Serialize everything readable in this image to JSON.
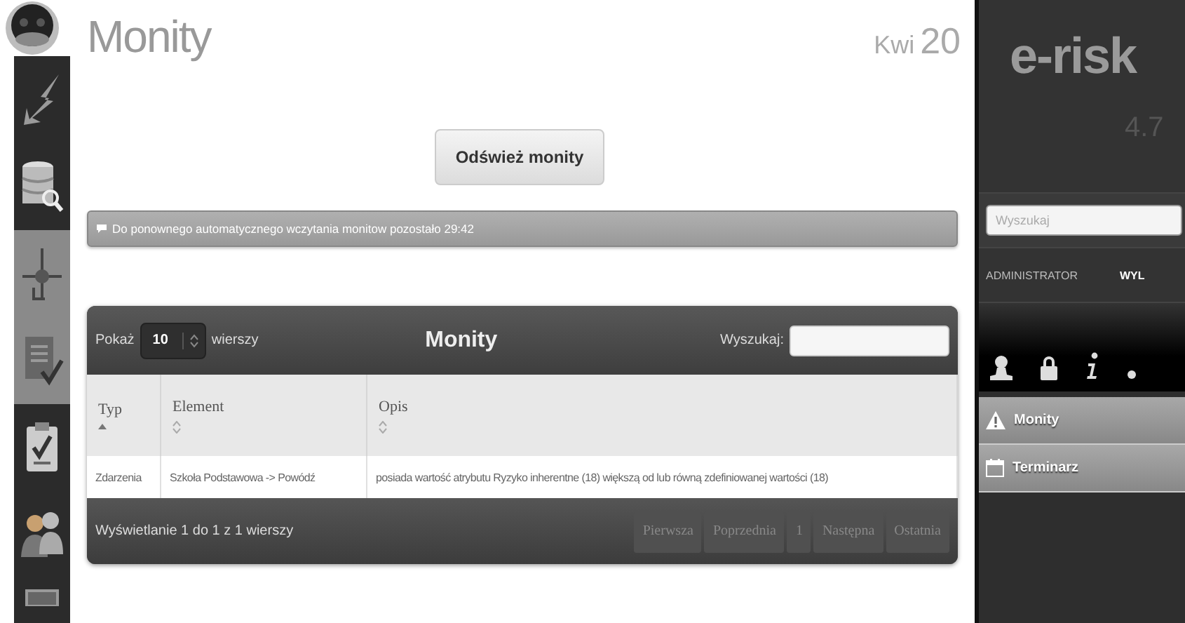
{
  "page": {
    "title": "Monity",
    "date": {
      "month": "Kwi",
      "day": "20"
    }
  },
  "refresh_button": "Odśwież monity",
  "notice": "Do ponownego automatycznego wczytania monitow pozostało 29:42",
  "table": {
    "title": "Monity",
    "length": {
      "label_before": "Pokaż",
      "value": "10",
      "label_after": "wierszy"
    },
    "search": {
      "label": "Wyszukaj:"
    },
    "columns": [
      {
        "label": "Typ",
        "sorted": true
      },
      {
        "label": "Element",
        "sorted": false
      },
      {
        "label": "Opis",
        "sorted": false
      }
    ],
    "rows": [
      [
        "Zdarzenia",
        "Szkoła Podstawowa -> Powódź",
        "posiada wartość atrybutu Ryzyko inherentne (18) większą od lub równą zdefiniowanej wartości (18)"
      ]
    ],
    "info": "Wyświetlanie 1 do 1 z 1 wierszy",
    "pagination": [
      {
        "label": "Pierwsza",
        "disabled": true
      },
      {
        "label": "Poprzednia",
        "disabled": true
      },
      {
        "label": "1",
        "disabled": true
      },
      {
        "label": "Następna",
        "disabled": true
      },
      {
        "label": "Ostatnia",
        "disabled": true
      }
    ]
  },
  "side_panel": {
    "logo": "e-risk",
    "version": "4.7",
    "search": {
      "placeholder": "Wyszukaj"
    },
    "user": "ADMINISTRATOR",
    "logout": "WYL",
    "menu": [
      {
        "label": "Monity"
      },
      {
        "label": "Terminarz"
      }
    ]
  }
}
